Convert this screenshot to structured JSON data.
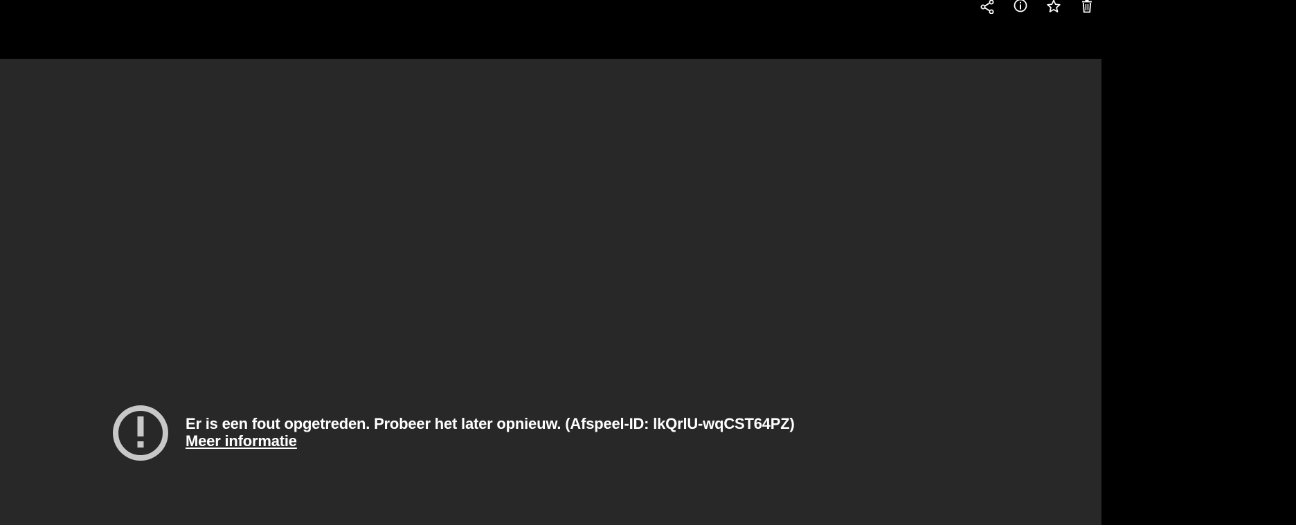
{
  "toolbar": {
    "icons": [
      "share-icon",
      "info-icon",
      "star-icon",
      "trash-icon"
    ],
    "icon_color": "#ffffff"
  },
  "player": {
    "background": "#282828",
    "error": {
      "message": "Er is een fout opgetreden. Probeer het later opnieuw. (Afspeel-ID: lkQrlU-wqCST64PZ)",
      "link_label": "Meer informatie",
      "icon": "alert-circle-icon",
      "icon_color": "#c8c8c8"
    }
  }
}
